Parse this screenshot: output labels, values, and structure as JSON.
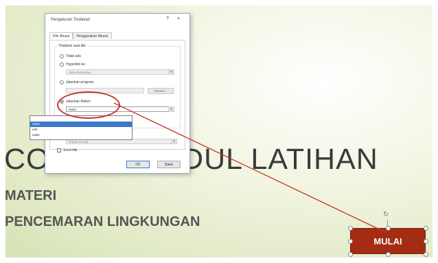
{
  "slide": {
    "title": "CONTOH JUDUL LATIHAN",
    "subtitle1": "MATERI",
    "subtitle2": "PENCEMARAN LINGKUNGAN",
    "button_label": "MULAI",
    "button_color": "#a42c12",
    "arrow_color": "#c0392b"
  },
  "dialog": {
    "title": "Pengaturan Tindakan",
    "help_glyph": "?",
    "close_glyph": "×",
    "tabs": [
      "Klik Mouse",
      "Penggerakan Mouse"
    ],
    "group_label": "Tindakan saat klik",
    "options": {
      "none": "Tidak ada",
      "hyperlink": "Hyperlink ke:",
      "hyperlink_value": "Slide Berikutnya",
      "run_program": "Jalankan program:",
      "browse": "Telusuri...",
      "run_macro": "Jalankan Makro:",
      "macro_value": "Mulai"
    },
    "dropdown_items": [
      "",
      "Mulai",
      "edit",
      "salah"
    ],
    "dropdown_selected_index": 1,
    "play_sound_value": "[Tanpa Suara]",
    "highlight_click": "Sorot klik",
    "ok": "OK",
    "cancel": "Batal"
  }
}
